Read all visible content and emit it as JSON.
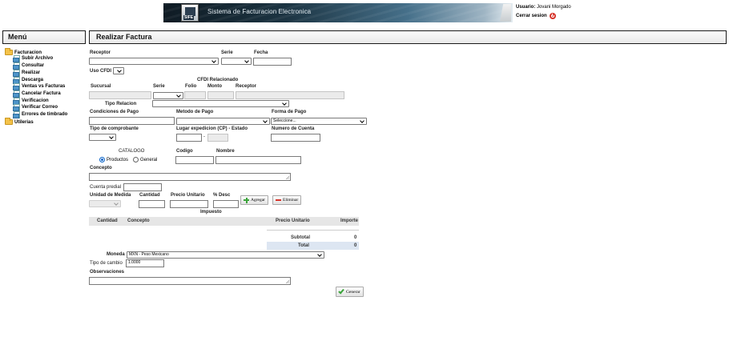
{
  "header": {
    "system_title": "Sistema de Facturacion Electronica",
    "logo_text": "SIFE",
    "user_label": "Usuario:",
    "user_name": "Jovani Morgado",
    "logout_label": "Cerrar sesion"
  },
  "menu": {
    "title": "Menú",
    "folders": [
      {
        "label": "Facturacion",
        "items": [
          "Subir Archivo",
          "Consultar",
          "Realizar",
          "Descarga",
          "Ventas vs Facturas",
          "Cancelar Factura",
          "Verificacion",
          "Verificar Correo",
          "Errores de timbrado"
        ]
      },
      {
        "label": "Utilerias",
        "items": []
      }
    ]
  },
  "form": {
    "title": "Realizar Factura",
    "receptor_label": "Receptor",
    "serie_label": "Serie",
    "fecha_label": "Fecha",
    "uso_cfdi_label": "Uso CFDI",
    "cfdi_relacionado_label": "CFDI Relacionado",
    "sucursal_label": "Sucursal",
    "rel_serie_label": "Serie",
    "folio_label": "Folio",
    "monto_label": "Monto",
    "rel_receptor_label": "Receptor",
    "tipo_relacion_label": "Tipo Relacion",
    "condiciones_pago_label": "Condiciones de Pago",
    "metodo_pago_label": "Metodo de Pago",
    "forma_pago_label": "Forma de Pago",
    "forma_pago_value": "Seleccione...",
    "tipo_comprobante_label": "Tipo de comprobante",
    "lugar_expedicion_label": "Lugar expedicion (CP) - Estado",
    "lugar_sep": "-",
    "numero_cuenta_label": "Numero de Cuenta",
    "catalogo_label": "CATALOGO",
    "codigo_label": "Codigo",
    "nombre_label": "Nombre",
    "radio_productos": "Productos",
    "radio_general": "General",
    "concepto_label": "Concepto",
    "cuenta_predial_label": "Cuenta predial",
    "unidad_medida_label": "Unidad de Medida",
    "cantidad_label": "Cantidad",
    "precio_unitario_label": "Precio Unitario",
    "desc_label": "% Desc",
    "impuesto_label": "Impuesto",
    "agregar_label": "Agregar",
    "eliminar_label": "Eliminar"
  },
  "table": {
    "headers": [
      "Cantidad",
      "Concepto",
      "Precio Unitario",
      "Importe"
    ],
    "subtotal_label": "Subtotal",
    "subtotal_value": "0",
    "total_label": "Total",
    "total_value": "0"
  },
  "footer_form": {
    "moneda_label": "Moneda",
    "moneda_value": "MXN - Peso Mexicano",
    "tipo_cambio_label": "Tipo de cambio",
    "tipo_cambio_value": "1.0000",
    "observaciones_label": "Observaciones",
    "generar_label": "Generar"
  },
  "colors": {
    "banner_dark": "#0f1b24",
    "banner_mid": "#46708a",
    "total_bg": "#dde6f2",
    "table_header_bg": "#e6e6e6",
    "logout_icon": "#d6332a",
    "add_icon": "#3aa33a",
    "remove_icon": "#d6332a",
    "check_icon": "#3aa33a"
  }
}
